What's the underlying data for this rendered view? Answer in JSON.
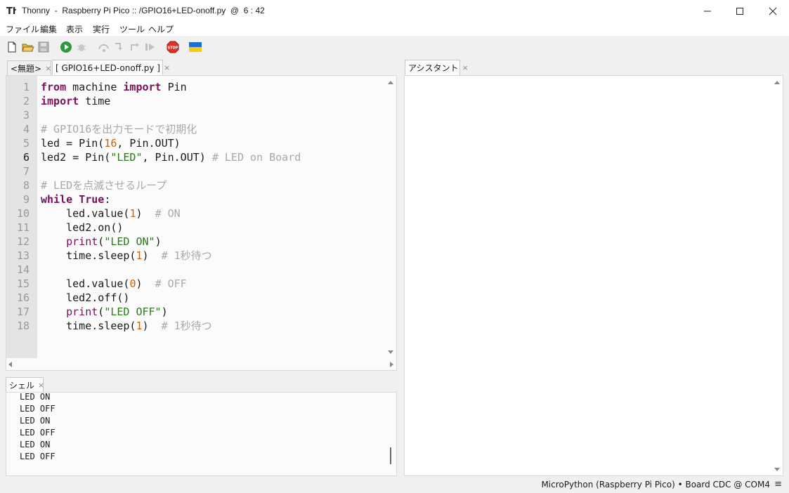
{
  "window": {
    "title": "Thonny  -  Raspberry Pi Pico :: /GPIO16+LED-onoff.py  @  6 : 42"
  },
  "menu": [
    "ファイル",
    "編集",
    "表示",
    "実行",
    "ツール",
    "ヘルプ"
  ],
  "tabs": {
    "editor": [
      {
        "label": "<無題>",
        "close": "×"
      },
      {
        "label": "[ GPIO16+LED-onoff.py ]",
        "close": "×"
      }
    ],
    "assistant": {
      "label": "アシスタント",
      "close": "×"
    },
    "shell": {
      "label": "シェル",
      "close": "×"
    }
  },
  "editor": {
    "current_line": 6,
    "line_numbers": [
      "1",
      "2",
      "3",
      "4",
      "5",
      "6",
      "7",
      "8",
      "9",
      "10",
      "11",
      "12",
      "13",
      "14",
      "15",
      "16",
      "17",
      "18"
    ]
  },
  "shell": {
    "lines": [
      "LED ON",
      "LED OFF",
      "LED ON",
      "LED OFF",
      "LED ON",
      "LED OFF"
    ]
  },
  "status": {
    "text": "MicroPython (Raspberry Pi Pico)  •  Board CDC @ COM4",
    "menu_glyph": "≡"
  },
  "colors": {
    "keyword": "#7a0f5c",
    "number": "#c9620a",
    "string": "#2b7a19",
    "comment": "#a8a8a8",
    "gutter": "#e4e4e4"
  },
  "icons": [
    "new-file-icon",
    "open-folder-icon",
    "save-icon",
    "run-icon",
    "debug-icon",
    "step-over-icon",
    "step-into-icon",
    "step-out-icon",
    "resume-icon",
    "stop-icon",
    "ukraine-flag-icon"
  ]
}
